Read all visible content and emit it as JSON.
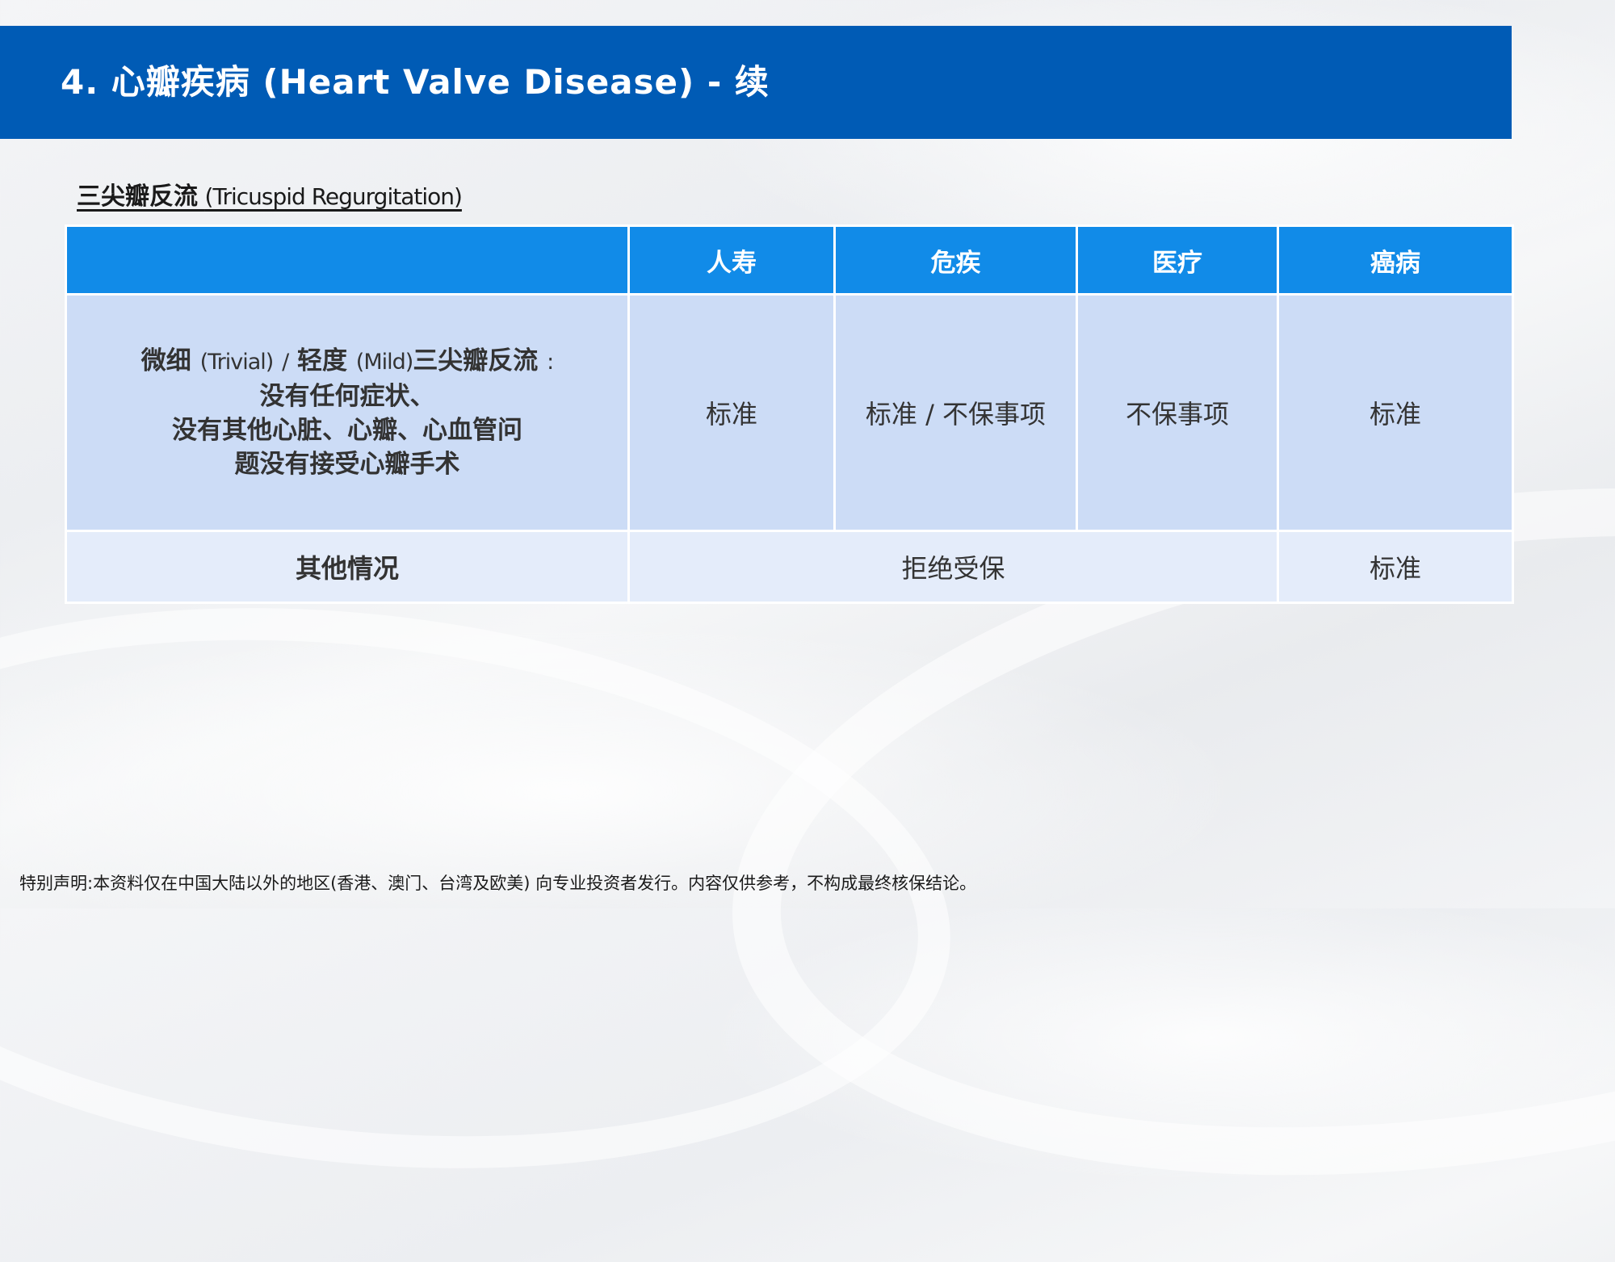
{
  "title": "4. 心瓣疾病 (Heart Valve Disease) - 续",
  "section": {
    "heading_zh": "三尖瓣反流",
    "heading_en": "(Tricuspid Regurgitation)"
  },
  "table": {
    "headers": [
      "",
      "人寿",
      "危疾",
      "医疗",
      "癌病"
    ],
    "row1": {
      "condition": {
        "part1_zh": "微细",
        "part1_en": "(Trivial)",
        "sep": "/",
        "part2_zh": "轻度",
        "part2_en": "(Mild)",
        "part3_zh": "三尖瓣反流",
        "colon": ":",
        "line2": "没有任何症状、",
        "line3": "没有其他心脏、心瓣、心血管问",
        "line4": "题没有接受心瓣手术"
      },
      "life": "标准",
      "critical_illness": "标准 / 不保事项",
      "medical": "不保事项",
      "cancer": "标准"
    },
    "row2": {
      "condition": "其他情况",
      "merged": "拒绝受保",
      "cancer": "标准"
    }
  },
  "disclaimer": "特别声明:本资料仅在中国大陆以外的地区(香港、澳门、台湾及欧美) 向专业投资者发行。内容仅供参考，不构成最终核保结论。",
  "colors": {
    "title_band": "#005bb5",
    "header_row": "#118be8",
    "row1_bg": "#ccdcf6",
    "row2_bg": "#e4ecfa"
  }
}
